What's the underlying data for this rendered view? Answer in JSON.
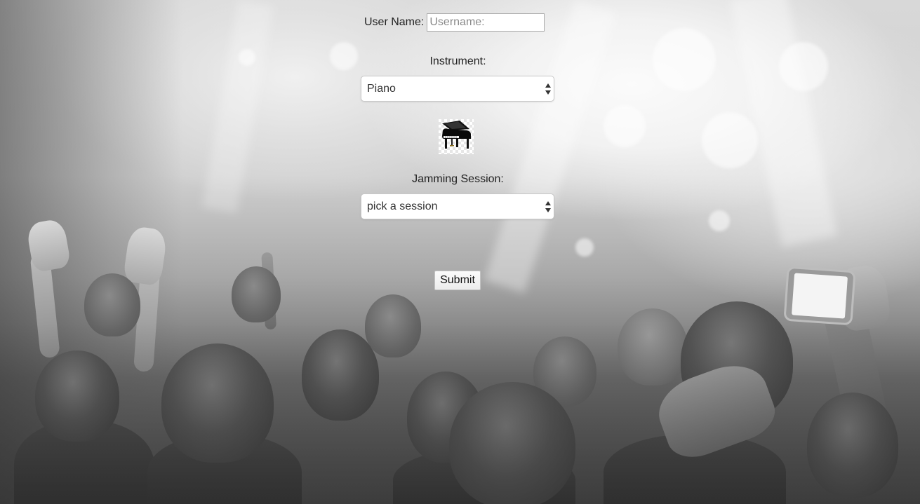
{
  "form": {
    "username": {
      "label": "User Name:",
      "placeholder": "Username:",
      "value": ""
    },
    "instrument": {
      "label": "Instrument:",
      "selected": "Piano",
      "image_icon": "grand-piano-icon"
    },
    "session": {
      "label": "Jamming Session:",
      "selected": "pick a session"
    },
    "submit_label": "Submit"
  },
  "background": {
    "description_icon": "concert-crowd-photo"
  }
}
